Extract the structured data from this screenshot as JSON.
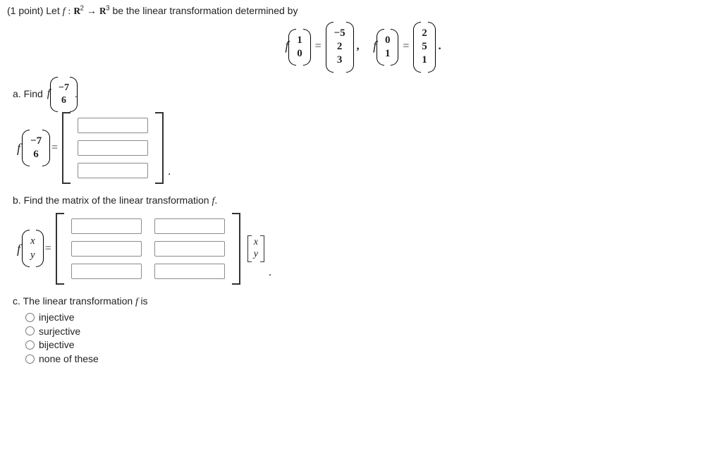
{
  "intro": {
    "points": "(1 point)",
    "text1": "Let",
    "text2": "be the linear transformation determined by",
    "func": "f",
    "colon": ":",
    "dom": "R",
    "dom_exp": "2",
    "arrow": "→",
    "cod": "R",
    "cod_exp": "3"
  },
  "defining": {
    "in1": [
      "1",
      "0"
    ],
    "out1": [
      "−5",
      "2",
      "3"
    ],
    "in2": [
      "0",
      "1"
    ],
    "out2": [
      "2",
      "5",
      "1"
    ]
  },
  "partA": {
    "label": "a. Find",
    "vec": [
      "−7",
      "6"
    ]
  },
  "partB": {
    "label": "b. Find the matrix of the linear transformation",
    "xy": [
      "x",
      "y"
    ]
  },
  "partC": {
    "label": "c. The linear transformation",
    "tail": "is",
    "opts": [
      "injective",
      "surjective",
      "bijective",
      "none of these"
    ]
  },
  "chart_data": {
    "type": "table",
    "title": "Linear transformation f : R^2 -> R^3",
    "given_mappings": [
      {
        "input": [
          1,
          0
        ],
        "output": [
          -5,
          2,
          3
        ]
      },
      {
        "input": [
          0,
          1
        ],
        "output": [
          2,
          5,
          1
        ]
      }
    ],
    "question_a_input": [
      -7,
      6
    ]
  }
}
